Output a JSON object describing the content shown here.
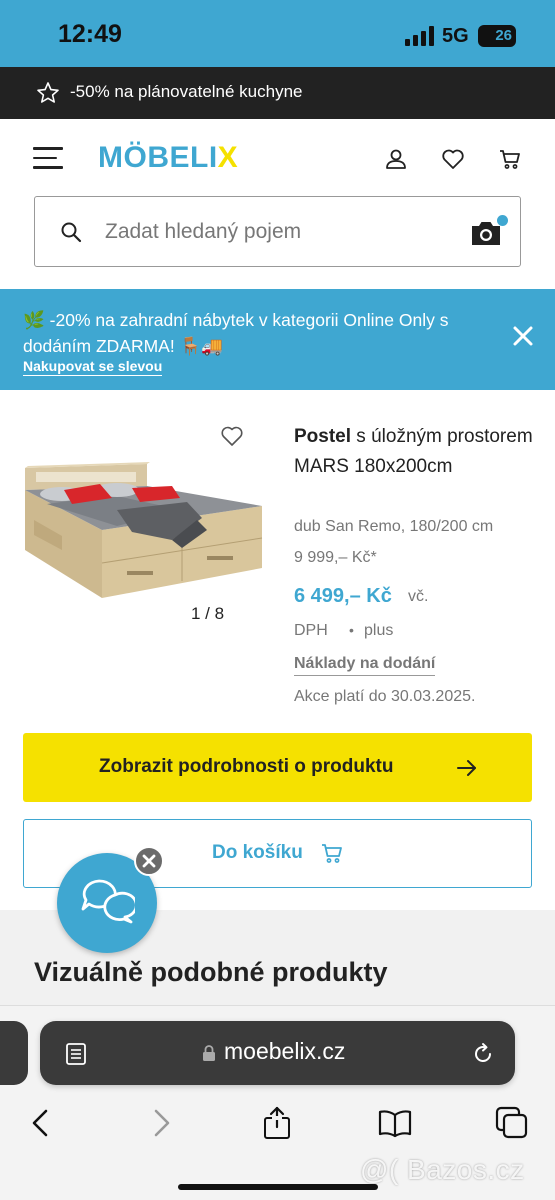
{
  "status": {
    "time": "12:49",
    "network": "5G",
    "battery": "26"
  },
  "promo_top": {
    "text": "-50% na plánovatelné kuchyne"
  },
  "header": {
    "logo_main": "MÖBELI",
    "logo_x": "X",
    "search_placeholder": "Zadat hledaný pojem"
  },
  "blue_promo": {
    "text": "🌿 -20% na zahradní nábytek v kategorii Online Only s dodáním ZDARMA! 🪑🚚",
    "link": "Nakupovat se slevou"
  },
  "product": {
    "title_bold": "Postel",
    "title_rest": " s úložným prostorem MARS 180x200cm",
    "variant": "dub San Remo, 180/200 cm",
    "old_price": "9 999,– Kč*",
    "new_price": "6 499,– Kč",
    "vat1": "vč.",
    "vat2": "DPH",
    "bullet": "•",
    "plus": "plus",
    "shipping": "Náklady na dodání",
    "valid_until": "Akce platí do 30.03.2025.",
    "pager": "1 / 8"
  },
  "buttons": {
    "details": "Zobrazit podrobnosti o produktu",
    "cart": "Do košíku"
  },
  "sections": {
    "similar_title": "Vizuálně podobné produkty"
  },
  "browser": {
    "url": "moebelix.cz"
  },
  "watermark": "@( Bazos.cz",
  "colors": {
    "brand_blue": "#3fa7d1",
    "brand_yellow": "#f5e100",
    "dark": "#222222"
  }
}
